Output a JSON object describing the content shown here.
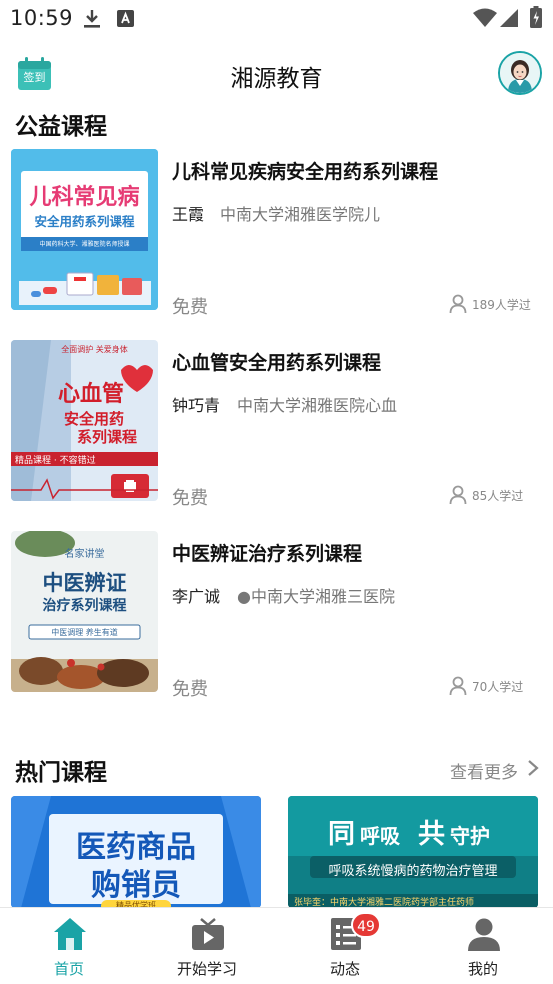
{
  "status_bar": {
    "time": "10:59",
    "left_icons": [
      "download-icon",
      "font-app-icon"
    ],
    "right_icons": [
      "wifi-icon",
      "signal-icon",
      "battery-charging-icon"
    ]
  },
  "header": {
    "signin_label": "签到",
    "title": "湘源教育"
  },
  "public_courses": {
    "title": "公益课程",
    "items": [
      {
        "title": "儿科常见疾病安全用药系列课程",
        "teacher": "王霞",
        "school": "中南大学湘雅医学院儿",
        "price": "免费",
        "learners": "189人学过",
        "thumb_line1": "儿科常见病",
        "thumb_line2": "安全用药系列课程",
        "thumb_line3": "中国药科大学、湘雅医院名师授课"
      },
      {
        "title": "心血管安全用药系列课程",
        "teacher": "钟巧青",
        "school": "中南大学湘雅医院心血",
        "price": "免费",
        "learners": "85人学过",
        "thumb_line1": "全面调护 关爱身体",
        "thumb_line2": "心血管",
        "thumb_line3": "安全用药",
        "thumb_line4": "系列课程",
        "thumb_line5": "精品课程 · 不容错过"
      },
      {
        "title": "中医辨证治疗系列课程",
        "teacher": "李广诚",
        "school": "●中南大学湘雅三医院",
        "price": "免费",
        "learners": "70人学过",
        "thumb_line1": "名家讲堂",
        "thumb_line2": "中医辨证",
        "thumb_line3": "治疗系列课程",
        "thumb_line4": "中医调理 养生有道"
      }
    ]
  },
  "hot_courses": {
    "title": "热门课程",
    "more_label": "查看更多",
    "cards": [
      {
        "line1": "医药商品",
        "line2": "购销员",
        "line3": "精品优学班"
      },
      {
        "line1a": "同",
        "line1b": "呼吸",
        "line1c": "共",
        "line1d": "守护",
        "line2": "呼吸系统慢病的药物治疗管理",
        "line3": "张毕奎：中南大学湘雅二医院药学部主任药师"
      }
    ]
  },
  "tab_bar": {
    "tabs": [
      {
        "label": "首页",
        "icon": "home-icon",
        "active": true
      },
      {
        "label": "开始学习",
        "icon": "tv-play-icon",
        "active": false
      },
      {
        "label": "动态",
        "icon": "news-list-icon",
        "active": false
      },
      {
        "label": "我的",
        "icon": "user-icon",
        "active": false
      }
    ],
    "badge": "49"
  },
  "colors": {
    "accent": "#1aa3a6",
    "badge": "#e53935",
    "muted_text": "#888888"
  }
}
